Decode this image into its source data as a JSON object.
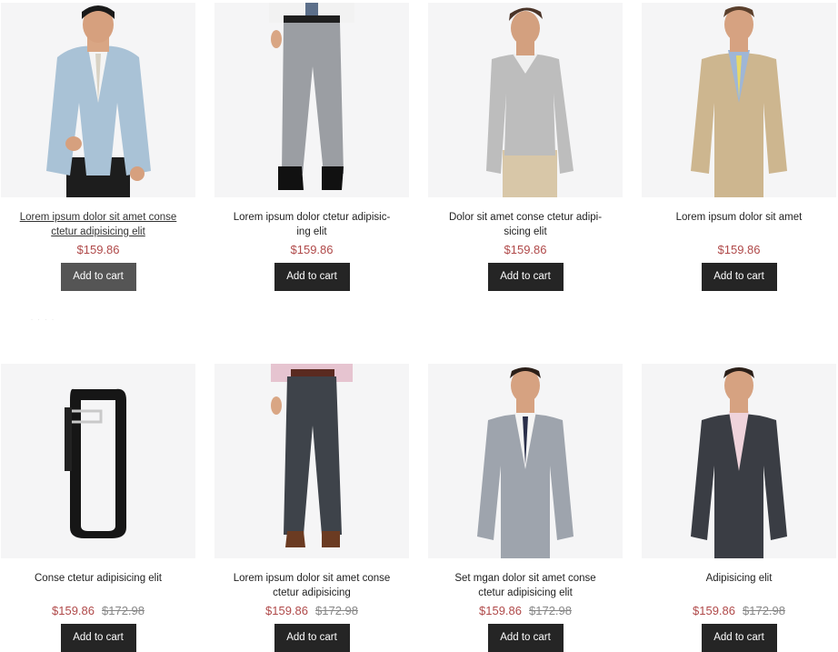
{
  "products": [
    {
      "title": "Lorem ipsum dolor sit amet conse ctetur adipisicing elit",
      "price": "$159.86",
      "old_price": "",
      "button": "Add to cart",
      "image": "light-blue-blazer"
    },
    {
      "title": "Lorem ipsum dolor ctetur adipisic-ing elit",
      "price": "$159.86",
      "old_price": "",
      "button": "Add to cart",
      "image": "grey-trousers"
    },
    {
      "title": "Dolor sit amet conse ctetur adipi-sicing elit",
      "price": "$159.86",
      "old_price": "",
      "button": "Add to cart",
      "image": "grey-sweater"
    },
    {
      "title": "Lorem ipsum dolor sit amet",
      "price": "$159.86",
      "old_price": "",
      "button": "Add to cart",
      "image": "tan-suit"
    },
    {
      "title": "Conse ctetur adipisicing elit",
      "price": "$159.86",
      "old_price": "$172.98",
      "button": "Add to cart",
      "image": "black-belt"
    },
    {
      "title": "Lorem ipsum dolor sit amet conse ctetur adipisicing",
      "price": "$159.86",
      "old_price": "$172.98",
      "button": "Add to cart",
      "image": "charcoal-trousers"
    },
    {
      "title": "Set mgan dolor sit amet conse ctetur adipisicing elit",
      "price": "$159.86",
      "old_price": "$172.98",
      "button": "Add to cart",
      "image": "grey-suit"
    },
    {
      "title": "Adipisicing elit",
      "price": "$159.86",
      "old_price": "$172.98",
      "button": "Add to cart",
      "image": "pinstripe-suit"
    }
  ],
  "colors": {
    "price": "#b04a4a",
    "button_bg": "#252525",
    "button_hover_bg": "#555555",
    "image_bg": "#f5f5f6"
  }
}
